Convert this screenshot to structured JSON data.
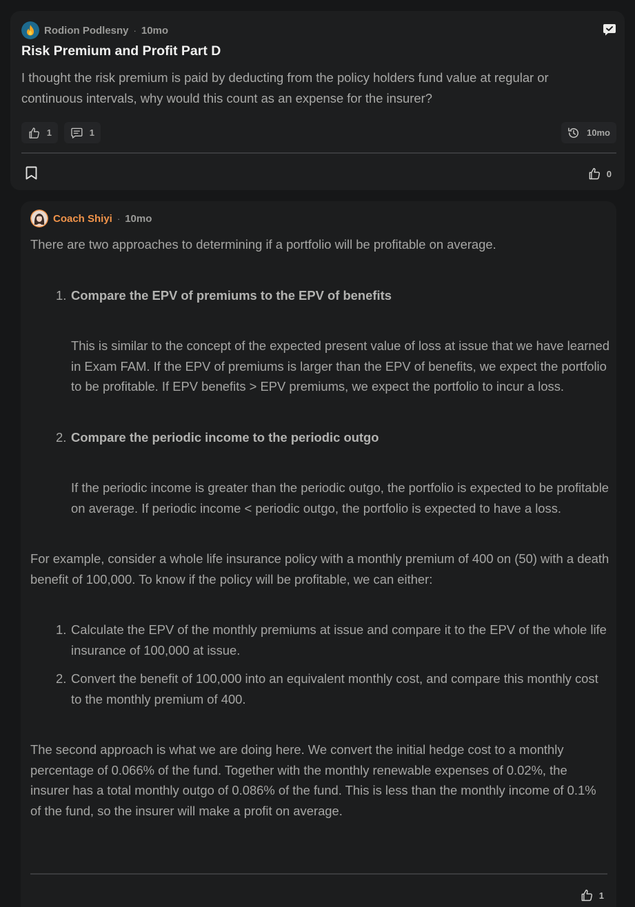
{
  "post": {
    "author": "Rodion Podlesny",
    "separator": "·",
    "time": "10mo",
    "title": "Risk Premium and Profit Part D",
    "body": "I thought the risk premium is paid by deducting from the policy holders fund value at regular or continuous intervals, why would this count as an expense for the insurer?",
    "likes": "1",
    "comments": "1",
    "history_time": "10mo",
    "votes": "0"
  },
  "reply": {
    "author": "Coach Shiyi",
    "separator": "·",
    "time": "10mo",
    "intro": "There are two approaches to determining if a portfolio will be profitable on average.",
    "approaches": [
      {
        "num": "1.",
        "title": "Compare the EPV of premiums to the EPV of benefits",
        "detail": "This is similar to the concept of the expected present value of loss at issue that we have learned in Exam FAM. If the EPV of premiums is larger than the EPV of benefits, we expect the portfolio to be profitable. If EPV benefits > EPV premiums, we expect the portfolio to incur a loss."
      },
      {
        "num": "2.",
        "title": "Compare the periodic income to the periodic outgo",
        "detail": "If the periodic income is greater than the periodic outgo, the portfolio is expected to be profitable on average. If periodic income < periodic outgo, the portfolio is expected to have a loss."
      }
    ],
    "example": "For example, consider a whole life insurance policy with a monthly premium of 400 on (50) with a death benefit of 100,000. To know if the policy will be profitable, we can either:",
    "steps": [
      {
        "num": "1.",
        "text": "Calculate the EPV of the monthly premiums at issue and compare it to the EPV of the whole life insurance of 100,000 at issue."
      },
      {
        "num": "2.",
        "text": "Convert the benefit of 100,000 into an equivalent monthly cost, and compare this monthly cost to the monthly premium of 400."
      }
    ],
    "conclusion": "The second approach is what we are doing here. We convert the initial hedge cost to a monthly percentage of 0.066% of the fund. Together with the monthly renewable expenses of 0.02%, the insurer has a total monthly outgo of 0.086% of the fund. This is less than the monthly income of 0.1% of the fund, so the insurer will make a profit on average.",
    "votes": "1"
  }
}
